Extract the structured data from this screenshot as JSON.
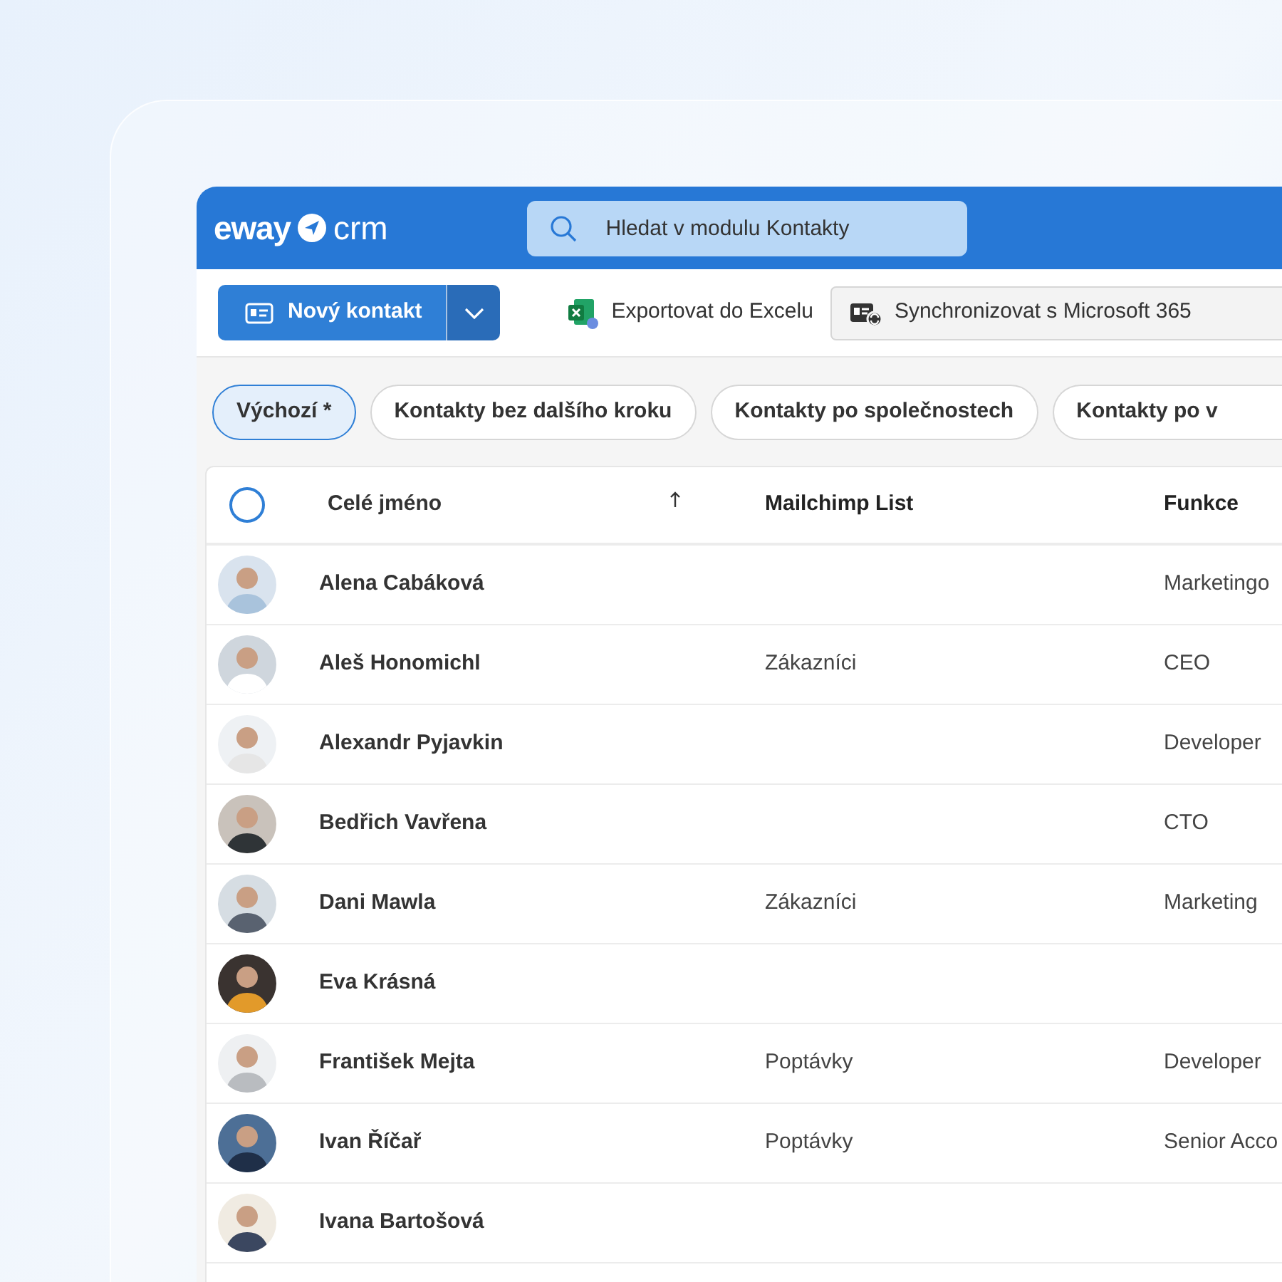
{
  "app": {
    "logo_left": "eway",
    "logo_right": "crm",
    "search": {
      "placeholder": "Hledat v modulu Kontakty"
    }
  },
  "toolbar": {
    "new_button": "Nový kontakt",
    "export": "Exportovat do Excelu",
    "sync": "Synchronizovat s Microsoft 365"
  },
  "views": [
    {
      "label": "Výchozí *",
      "selected": true
    },
    {
      "label": "Kontakty bez dalšího kroku",
      "selected": false
    },
    {
      "label": "Kontakty po společnostech",
      "selected": false
    },
    {
      "label": "Kontakty po v",
      "selected": false
    }
  ],
  "table": {
    "select_all": {
      "checked": false
    },
    "columns": [
      {
        "label": "Celé jméno",
        "sorted_ascending": true
      },
      {
        "label": "Mailchimp List"
      },
      {
        "label": "Funkce"
      }
    ],
    "rows": [
      {
        "name": "Alena Cabáková",
        "funkce": "Marketingo"
      },
      {
        "name": "Aleš Honomichl",
        "mailchimp": "Zákazníci",
        "funkce": "CEO"
      },
      {
        "name": "Alexandr Pyjavkin",
        "funkce": "Developer"
      },
      {
        "name": "Bedřich Vavřena",
        "funkce": "CTO"
      },
      {
        "name": "Dani Mawla",
        "mailchimp": "Zákazníci",
        "funkce": "Marketing"
      },
      {
        "name": "Eva Krásná"
      },
      {
        "name": "František Mejta",
        "mailchimp": "Poptávky",
        "funkce": "Developer"
      },
      {
        "name": "Ivan Říčař",
        "mailchimp": "Poptávky",
        "funkce": "Senior Acco"
      },
      {
        "name": "Ivana Bartošová"
      }
    ]
  }
}
